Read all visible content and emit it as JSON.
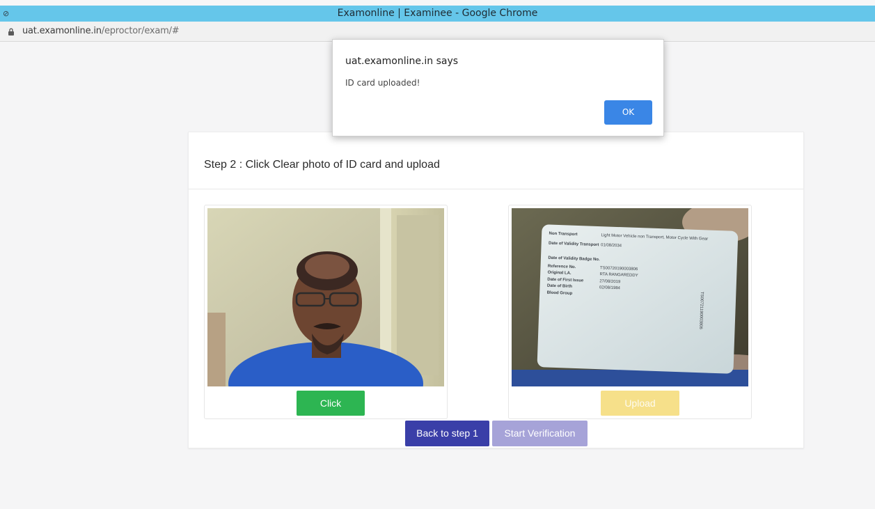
{
  "window": {
    "title": "Examonline | Examinee - Google Chrome"
  },
  "address_bar": {
    "url_host": "uat.examonline.in",
    "url_path": "/eproctor/exam/#",
    "lock_icon": "lock-icon"
  },
  "step": {
    "heading": "Step 2 : Click Clear photo of ID card and upload"
  },
  "left_panel": {
    "image_alt": "webcam photo of examinee",
    "button_label": "Click",
    "button_color": "#2db552"
  },
  "right_panel": {
    "image_alt": "photo of ID card",
    "button_label": "Upload",
    "button_color": "#f6e08a"
  },
  "id_card": {
    "rows": [
      {
        "label": "Non Transport",
        "value": "Light Motor Vehicle non Transport, Motor Cycle With Gear"
      },
      {
        "label": "Date of Validity Transport",
        "value": "01/08/2034"
      },
      {
        "label": "Date of Validity Badge No.",
        "value": ""
      },
      {
        "label": "Reference No.",
        "value": "TS00720190003806"
      },
      {
        "label": "Original LA.",
        "value": "RTA RANGAREDDY"
      },
      {
        "label": "Date of First Issue",
        "value": "27/08/2019"
      },
      {
        "label": "Date of Birth",
        "value": "02/08/1984"
      },
      {
        "label": "Blood Group",
        "value": ""
      }
    ],
    "side_number": "TS00721190003806"
  },
  "footer_buttons": {
    "back_label": "Back to step 1",
    "start_label": "Start Verification"
  },
  "alert": {
    "title": "uat.examonline.in says",
    "message": "ID card uploaded!",
    "ok_label": "OK"
  },
  "colors": {
    "titlebar": "#65c6ea",
    "back_button": "#3a3fa8",
    "start_button": "#a6a3d8",
    "ok_button": "#3a86e6"
  }
}
